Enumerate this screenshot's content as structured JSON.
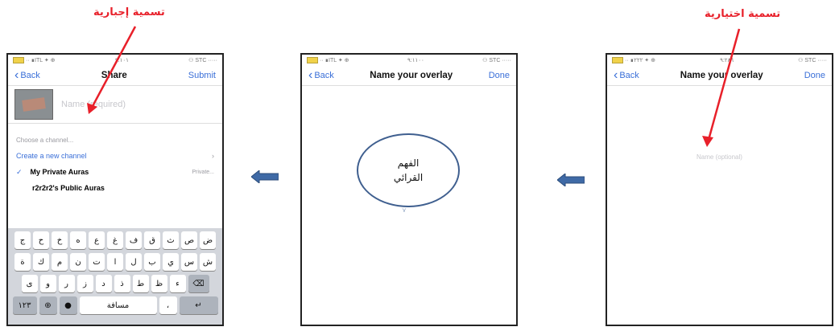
{
  "captions": {
    "left": "تسمية إجبارية",
    "right": "تسمية اختيارية"
  },
  "colors": {
    "accent": "#3a6fd8",
    "annotation": "#e8202a",
    "flow_arrow": "#3f6aa6"
  },
  "status_bars": {
    "left": {
      "carrier": "·· ∎ITL ✦ ⊕",
      "time": "٩:١٠١",
      "right": "⚇ STC ·····"
    },
    "middle": {
      "carrier": "·· ∎ITL ✦ ⊕",
      "time": "٩:١١٠٠",
      "right": "⚇ STC ·····"
    },
    "right": {
      "carrier": "·· ∎٢٢٢ ✦ ⊕",
      "time": "٩:٢٨٦",
      "right": "⚇ STC ·····"
    }
  },
  "share_screen": {
    "back_label": "Back",
    "title": "Share",
    "submit_label": "Submit",
    "name_placeholder": "Name (required)",
    "channel_heading": "Choose a channel...",
    "create_channel_label": "Create a new channel",
    "channels": [
      {
        "label": "My Private Auras",
        "meta": "Private..."
      },
      {
        "label": "r2r2r2's Public Auras",
        "meta": ""
      }
    ],
    "keyboard": {
      "row1": [
        "ض",
        "ص",
        "ث",
        "ق",
        "ف",
        "غ",
        "ع",
        "ه",
        "خ",
        "ح",
        "ج"
      ],
      "row2": [
        "ش",
        "س",
        "ي",
        "ب",
        "ل",
        "ا",
        "ت",
        "ن",
        "م",
        "ك",
        "ة"
      ],
      "row3": [
        "ء",
        "ظ",
        "ط",
        "ذ",
        "د",
        "ز",
        "ر",
        "و",
        "ى"
      ],
      "numbers_key": "١٢٣",
      "space_label": "مسافة",
      "return_label": "↵"
    }
  },
  "overlay_screen": {
    "back_label": "Back",
    "title": "Name your overlay",
    "done_label": "Done",
    "circle_text_line1": "الفهم",
    "circle_text_line2": "القرائي"
  },
  "overlay_screen_empty": {
    "back_label": "Back",
    "title": "Name your overlay",
    "done_label": "Done",
    "name_placeholder": "Name (optional)"
  }
}
